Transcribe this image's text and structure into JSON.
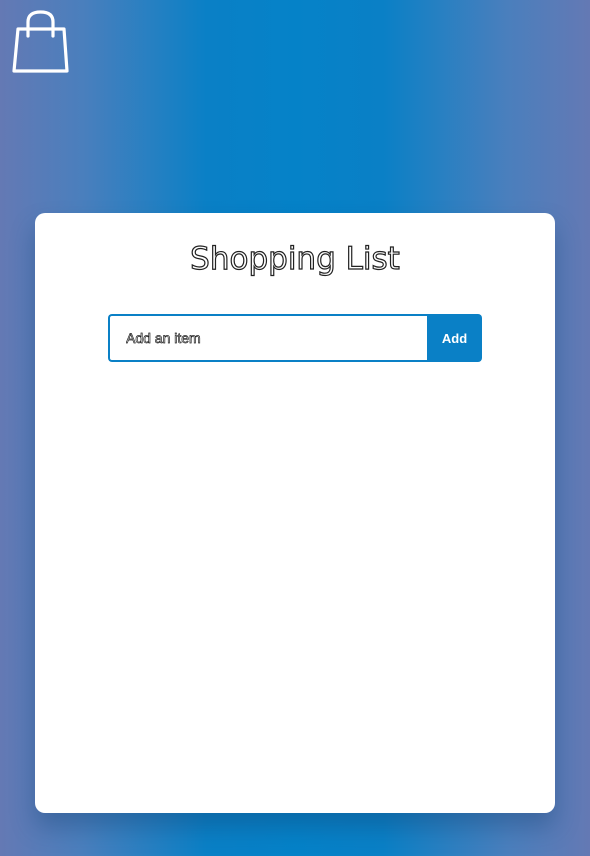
{
  "app": {
    "title": "Shopping List",
    "icon": "shopping-bag-icon"
  },
  "form": {
    "input_value": "",
    "input_placeholder": "Add an item",
    "add_label": "Add"
  },
  "items": [],
  "colors": {
    "accent": "#0a80c6",
    "card": "#ffffff",
    "background_edge": "#6479b4"
  }
}
